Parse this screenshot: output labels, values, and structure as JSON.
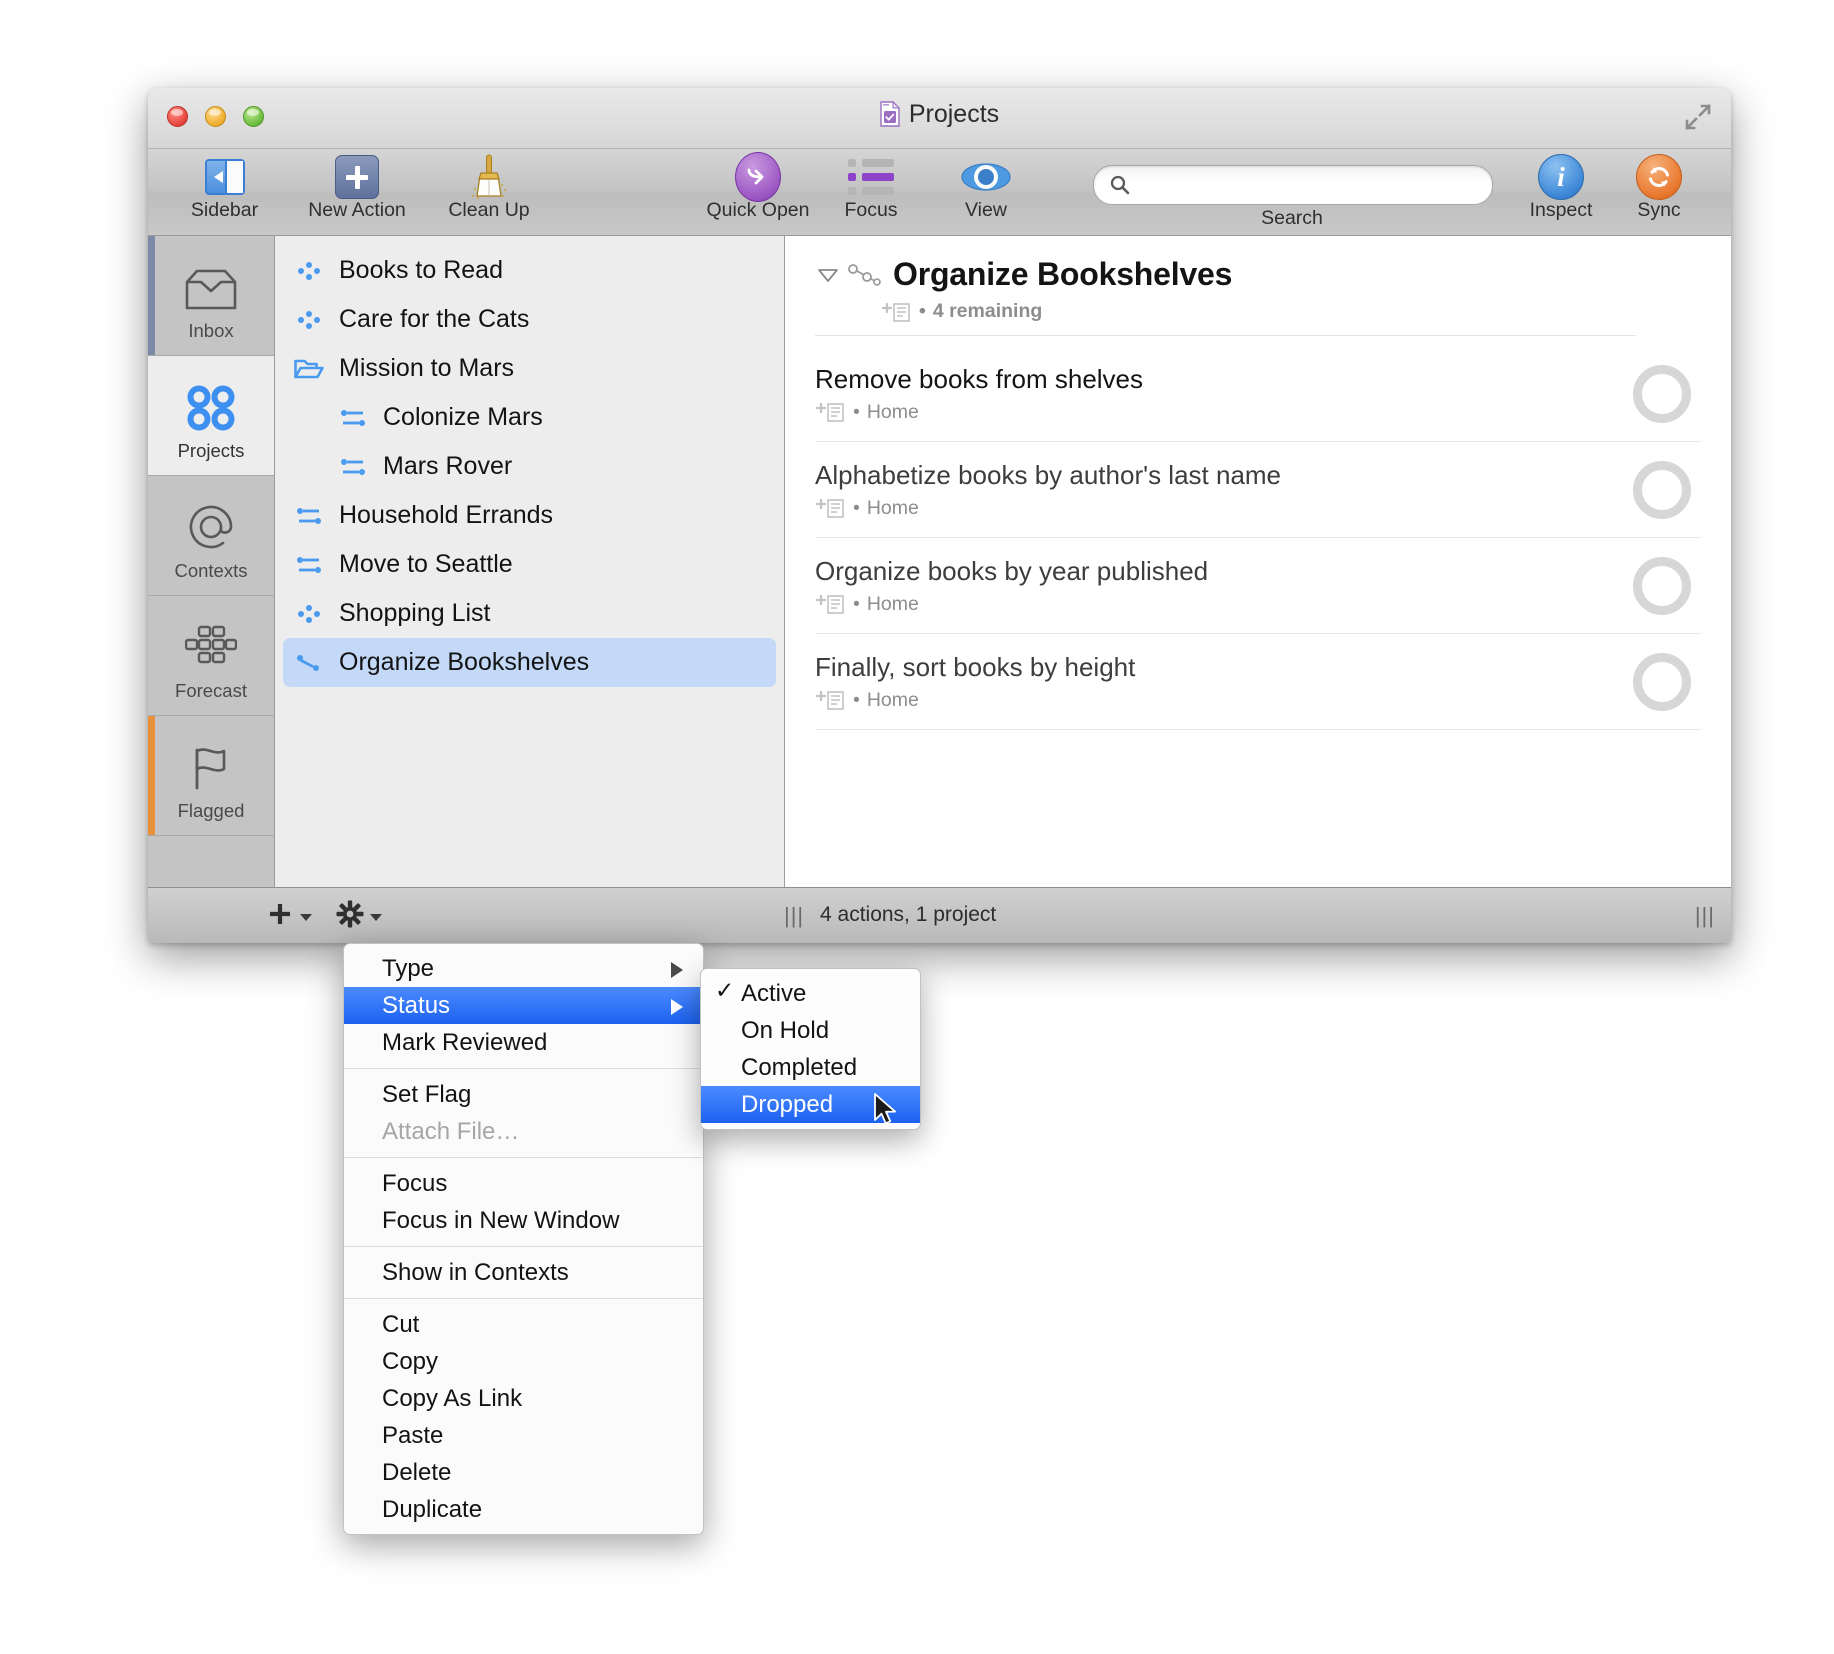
{
  "window": {
    "title": "Projects",
    "title_icon": "document-check-icon",
    "fullscreen_icon": "fullscreen-icon",
    "traffic_lights": [
      "close-button",
      "minimize-button",
      "zoom-button"
    ]
  },
  "toolbar": {
    "items": [
      {
        "label": "Sidebar",
        "icon": "sidebar-toggle-icon"
      },
      {
        "label": "New Action",
        "icon": "plus-icon"
      },
      {
        "label": "Clean Up",
        "icon": "broom-icon"
      },
      {
        "label": "Quick Open",
        "icon": "quick-open-arrow-icon"
      },
      {
        "label": "Focus",
        "icon": "focus-list-icon"
      },
      {
        "label": "View",
        "icon": "eye-icon"
      },
      {
        "label": "Inspect",
        "icon": "info-icon"
      },
      {
        "label": "Sync",
        "icon": "sync-refresh-icon"
      }
    ],
    "search": {
      "label": "Search",
      "value": "",
      "placeholder": "",
      "icon": "search-icon"
    }
  },
  "rail": {
    "items": [
      {
        "label": "Inbox",
        "icon": "inbox-tray-icon",
        "selected": false,
        "edge_color": "#7b8aa6"
      },
      {
        "label": "Projects",
        "icon": "projects-dots-icon",
        "selected": true,
        "edge_color": ""
      },
      {
        "label": "Contexts",
        "icon": "at-sign-icon",
        "selected": false,
        "edge_color": ""
      },
      {
        "label": "Forecast",
        "icon": "calendar-grid-icon",
        "selected": false,
        "edge_color": ""
      },
      {
        "label": "Flagged",
        "icon": "flag-icon",
        "selected": false,
        "edge_color": "#e8913a"
      }
    ]
  },
  "project_list": {
    "items": [
      {
        "label": "Books to Read",
        "icon": "parallel-project-icon",
        "indent": 0,
        "selected": false
      },
      {
        "label": "Care for the Cats",
        "icon": "parallel-project-icon",
        "indent": 0,
        "selected": false
      },
      {
        "label": "Mission to Mars",
        "icon": "folder-icon",
        "indent": 0,
        "selected": false
      },
      {
        "label": "Colonize Mars",
        "icon": "sequential-project-icon",
        "indent": 1,
        "selected": false
      },
      {
        "label": "Mars Rover",
        "icon": "sequential-project-icon",
        "indent": 1,
        "selected": false
      },
      {
        "label": "Household Errands",
        "icon": "sequential-project-icon",
        "indent": 0,
        "selected": false
      },
      {
        "label": "Move to Seattle",
        "icon": "sequential-project-icon",
        "indent": 0,
        "selected": false
      },
      {
        "label": "Shopping List",
        "icon": "parallel-project-icon",
        "indent": 0,
        "selected": false
      },
      {
        "label": "Organize Bookshelves",
        "icon": "single-action-icon",
        "indent": 0,
        "selected": true
      }
    ]
  },
  "content": {
    "project": {
      "title": "Organize Bookshelves",
      "disclosure_icon": "disclosure-triangle-icon",
      "type_icon": "sequential-project-icon",
      "note_icon": "add-note-icon",
      "meta": "4 remaining",
      "separator": "•"
    },
    "tasks": [
      {
        "name": "Remove books from shelves",
        "context": "Home",
        "note_icon": "add-note-icon",
        "checkbox": "task-checkbox",
        "available": true
      },
      {
        "name": "Alphabetize books by author's last name",
        "context": "Home",
        "note_icon": "add-note-icon",
        "checkbox": "task-checkbox",
        "available": false
      },
      {
        "name": "Organize books by year published",
        "context": "Home",
        "note_icon": "add-note-icon",
        "checkbox": "task-checkbox",
        "available": false
      },
      {
        "name": "Finally, sort books by height",
        "context": "Home",
        "note_icon": "add-note-icon",
        "checkbox": "task-checkbox",
        "available": false
      }
    ]
  },
  "statusbar": {
    "add_icon": "plus-icon",
    "gear_icon": "gear-icon",
    "grip_left": "|||",
    "grip_right": "|||",
    "status": "4 actions, 1 project"
  },
  "context_menu": {
    "items": [
      {
        "label": "Type",
        "submenu": true,
        "highlighted": false,
        "disabled": false
      },
      {
        "label": "Status",
        "submenu": true,
        "highlighted": true,
        "disabled": false
      },
      {
        "label": "Mark Reviewed",
        "submenu": false,
        "highlighted": false,
        "disabled": false
      },
      {
        "separator": true
      },
      {
        "label": "Set Flag",
        "submenu": false,
        "highlighted": false,
        "disabled": false
      },
      {
        "label": "Attach File…",
        "submenu": false,
        "highlighted": false,
        "disabled": true
      },
      {
        "separator": true
      },
      {
        "label": "Focus",
        "submenu": false,
        "highlighted": false,
        "disabled": false
      },
      {
        "label": "Focus in New Window",
        "submenu": false,
        "highlighted": false,
        "disabled": false
      },
      {
        "separator": true
      },
      {
        "label": "Show in Contexts",
        "submenu": false,
        "highlighted": false,
        "disabled": false
      },
      {
        "separator": true
      },
      {
        "label": "Cut",
        "submenu": false,
        "highlighted": false,
        "disabled": false
      },
      {
        "label": "Copy",
        "submenu": false,
        "highlighted": false,
        "disabled": false
      },
      {
        "label": "Copy As Link",
        "submenu": false,
        "highlighted": false,
        "disabled": false
      },
      {
        "label": "Paste",
        "submenu": false,
        "highlighted": false,
        "disabled": false
      },
      {
        "label": "Delete",
        "submenu": false,
        "highlighted": false,
        "disabled": false
      },
      {
        "label": "Duplicate",
        "submenu": false,
        "highlighted": false,
        "disabled": false
      }
    ]
  },
  "status_submenu": {
    "items": [
      {
        "label": "Active",
        "checked": true,
        "highlighted": false
      },
      {
        "label": "On Hold",
        "checked": false,
        "highlighted": false
      },
      {
        "label": "Completed",
        "checked": false,
        "highlighted": false
      },
      {
        "label": "Dropped",
        "checked": false,
        "highlighted": true
      }
    ],
    "check_glyph": "✓"
  },
  "cursor": {
    "icon": "mouse-pointer-icon"
  },
  "colors": {
    "accent_blue": "#1d62f0",
    "selection_blue": "#c3d9f7",
    "project_icon_blue": "#4a9bf0",
    "flag_orange": "#e8913a",
    "sync_orange": "#e8762c",
    "quick_open_purple": "#9a55c2"
  }
}
